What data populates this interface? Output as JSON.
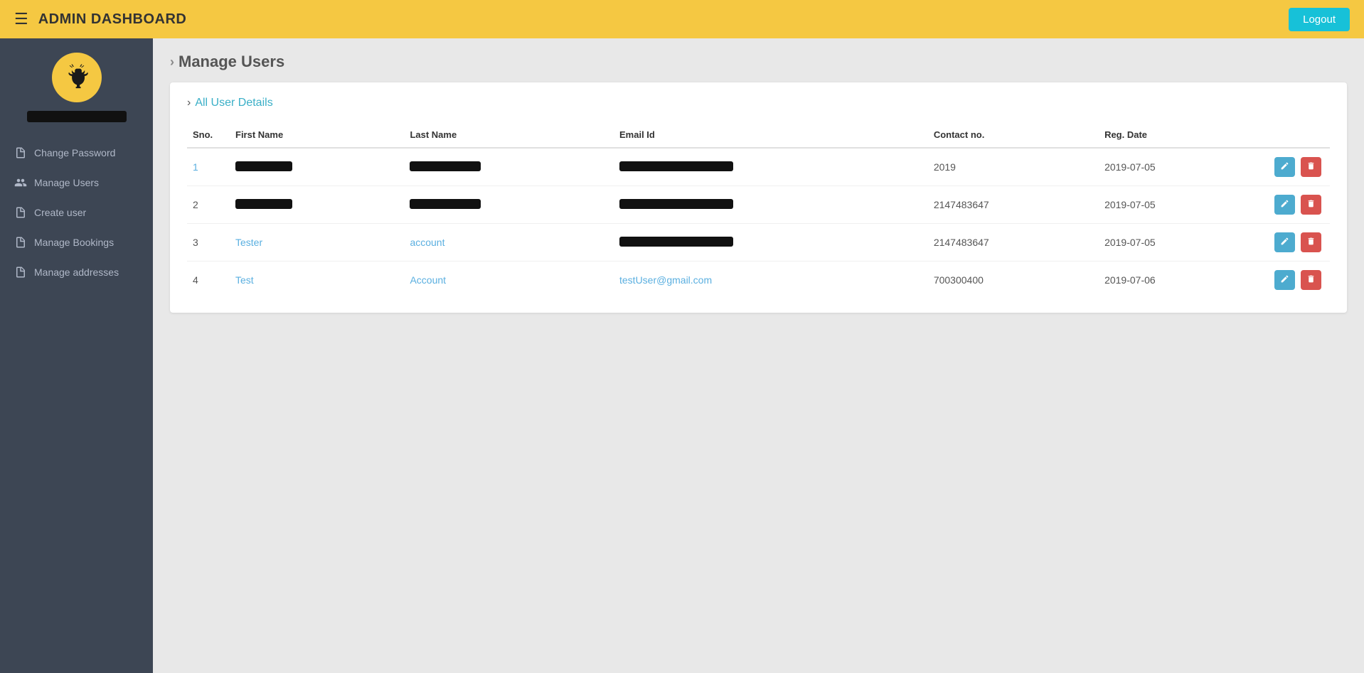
{
  "header": {
    "title": "ADMIN DASHBOARD",
    "logout_label": "Logout"
  },
  "sidebar": {
    "items": [
      {
        "id": "change-password",
        "label": "Change Password",
        "icon": "file"
      },
      {
        "id": "manage-users",
        "label": "Manage Users",
        "icon": "users"
      },
      {
        "id": "create-user",
        "label": "Create user",
        "icon": "file"
      },
      {
        "id": "manage-bookings",
        "label": "Manage Bookings",
        "icon": "file"
      },
      {
        "id": "manage-addresses",
        "label": "Manage addresses",
        "icon": "file"
      }
    ]
  },
  "page": {
    "title": "Manage Users",
    "section_title": "All User Details"
  },
  "table": {
    "columns": [
      "Sno.",
      "First Name",
      "Last Name",
      "Email Id",
      "Contact no.",
      "Reg. Date",
      ""
    ],
    "rows": [
      {
        "sno": "1",
        "first_name": null,
        "last_name": null,
        "email": null,
        "contact": "2019",
        "reg_date": "2019-07-05",
        "is_redacted": true,
        "link_style": false
      },
      {
        "sno": "2",
        "first_name": null,
        "last_name": null,
        "email": null,
        "contact": "2147483647",
        "reg_date": "2019-07-05",
        "is_redacted": true,
        "link_style": false
      },
      {
        "sno": "3",
        "first_name": "Tester",
        "last_name": "account",
        "email": null,
        "contact": "2147483647",
        "reg_date": "2019-07-05",
        "is_redacted": false,
        "link_style": true,
        "email_redacted": true
      },
      {
        "sno": "4",
        "first_name": "Test",
        "last_name": "Account",
        "email": "testUser@gmail.com",
        "contact": "700300400",
        "reg_date": "2019-07-06",
        "is_redacted": false,
        "link_style": true,
        "email_redacted": false
      }
    ]
  }
}
